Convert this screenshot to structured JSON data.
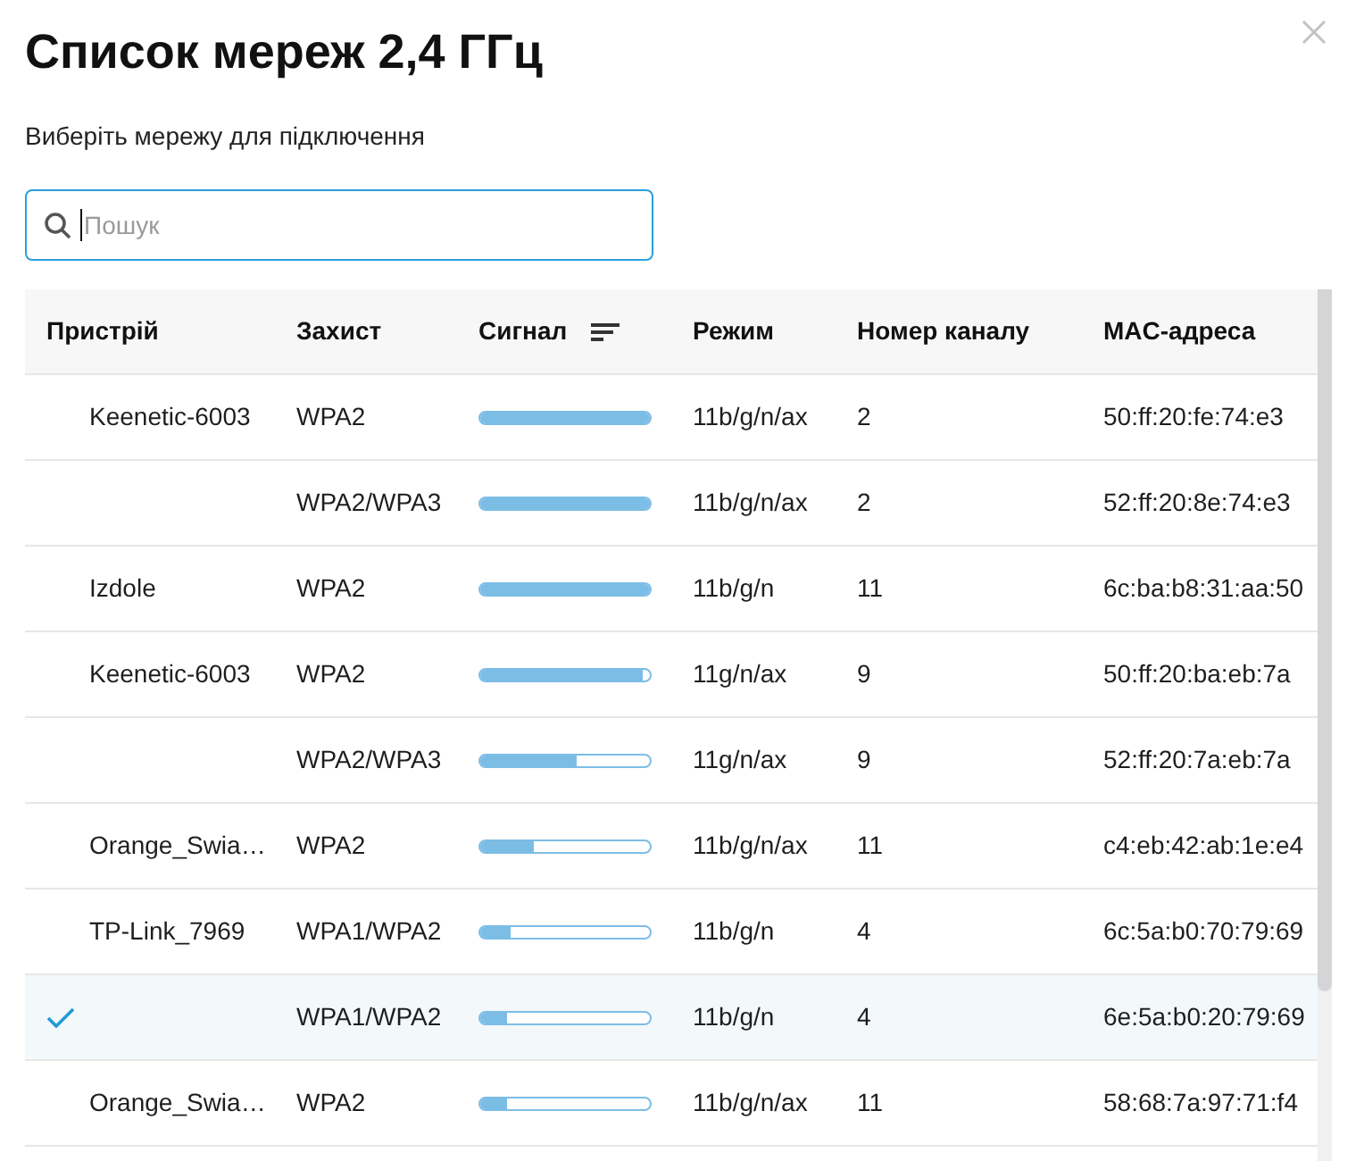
{
  "dialog": {
    "title": "Список мереж 2,4 ГГц",
    "subtitle": "Виберіть мережу для підключення"
  },
  "search": {
    "placeholder": "Пошук",
    "focused": true
  },
  "table": {
    "columns": [
      {
        "label": "Пристрій",
        "sorted": false
      },
      {
        "label": "Захист",
        "sorted": false
      },
      {
        "label": "Сигнал",
        "sorted": true
      },
      {
        "label": "Режим",
        "sorted": false
      },
      {
        "label": "Номер каналу",
        "sorted": false
      },
      {
        "label": "MAC-адреса",
        "sorted": false
      }
    ],
    "rows": [
      {
        "device": "Keenetic-6003",
        "security": "WPA2",
        "level": 1,
        "mode": "11b/g/n/ax",
        "channel": "2",
        "mac": "50:ff:20:fe:74:e3",
        "selected": false
      },
      {
        "security": "WPA2/WPA3",
        "level": 1,
        "mode": "11b/g/n/ax",
        "channel": "2",
        "mac": "52:ff:20:8e:74:e3",
        "selected": false
      },
      {
        "device": "Izdole",
        "security": "WPA2",
        "level": 1,
        "mode": "11b/g/n",
        "channel": "11",
        "mac": "6c:ba:b8:31:aa:50",
        "selected": false
      },
      {
        "device": "Keenetic-6003",
        "security": "WPA2",
        "level": 0.96,
        "mode": "11g/n/ax",
        "channel": "9",
        "mac": "50:ff:20:ba:eb:7a",
        "selected": false
      },
      {
        "security": "WPA2/WPA3",
        "level": 0.57,
        "mode": "11g/n/ax",
        "channel": "9",
        "mac": "52:ff:20:7a:eb:7a",
        "selected": false
      },
      {
        "device": "Orange_Swia…",
        "security": "WPA2",
        "level": 0.32,
        "mode": "11b/g/n/ax",
        "channel": "11",
        "mac": "c4:eb:42:ab:1e:e4",
        "selected": false
      },
      {
        "device": "TP-Link_7969",
        "security": "WPA1/WPA2",
        "level": 0.18,
        "mode": "11b/g/n",
        "channel": "4",
        "mac": "6c:5a:b0:70:79:69",
        "selected": false
      },
      {
        "security": "WPA1/WPA2",
        "level": 0.16,
        "mode": "11b/g/n",
        "channel": "4",
        "mac": "6e:5a:b0:20:79:69",
        "selected": true
      },
      {
        "device": "Orange_Swia…",
        "security": "WPA2",
        "level": 0.16,
        "mode": "11b/g/n/ax",
        "channel": "11",
        "mac": "58:68:7a:97:71:f4",
        "selected": false
      }
    ]
  }
}
